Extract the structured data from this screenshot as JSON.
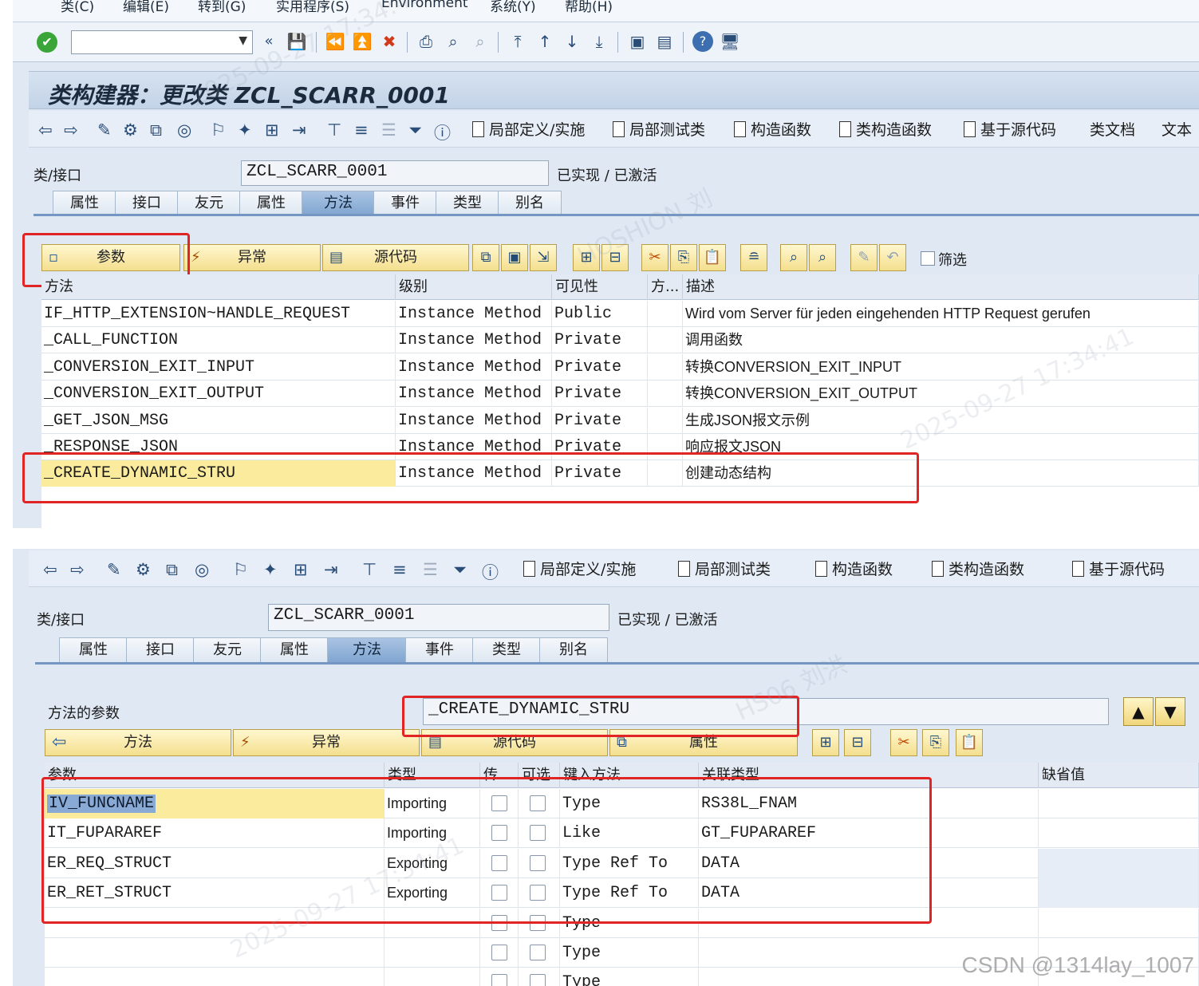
{
  "menu": [
    "类(C)",
    "编辑(E)",
    "转到(G)",
    "实用程序(S)",
    "Environment",
    "系统(Y)",
    "帮助(H)"
  ],
  "title": "类构建器：更改类 ZCL_SCARR_0001",
  "app_toolbar": {
    "local_def": "局部定义/实施",
    "local_test": "局部测试类",
    "constructor": "构造函数",
    "class_constructor": "类构造函数",
    "source_based": "基于源代码",
    "class_doc": "类文档",
    "text": "文本"
  },
  "class_field": {
    "label": "类/接口",
    "value": "ZCL_SCARR_0001",
    "status": "已实现 / 已激活"
  },
  "tabs": [
    "属性",
    "接口",
    "友元",
    "属性",
    "方法",
    "事件",
    "类型",
    "别名"
  ],
  "active_tab": "方法",
  "methods_toolbar": {
    "params": "参数",
    "exceptions": "异常",
    "source": "源代码",
    "filter": "筛选"
  },
  "methods_table": {
    "columns": [
      "方法",
      "级别",
      "可见性",
      "方...",
      "描述"
    ],
    "rows": [
      {
        "method": "IF_HTTP_EXTENSION~HANDLE_REQUEST",
        "level": "Instance Method",
        "visibility": "Public",
        "desc": "Wird vom Server für jeden eingehenden HTTP Request gerufen"
      },
      {
        "method": "_CALL_FUNCTION",
        "level": "Instance Method",
        "visibility": "Private",
        "desc": "调用函数"
      },
      {
        "method": "_CONVERSION_EXIT_INPUT",
        "level": "Instance Method",
        "visibility": "Private",
        "desc": "转换CONVERSION_EXIT_INPUT"
      },
      {
        "method": "_CONVERSION_EXIT_OUTPUT",
        "level": "Instance Method",
        "visibility": "Private",
        "desc": "转换CONVERSION_EXIT_OUTPUT"
      },
      {
        "method": "_GET_JSON_MSG",
        "level": "Instance Method",
        "visibility": "Private",
        "desc": "生成JSON报文示例"
      },
      {
        "method": "_RESPONSE_JSON",
        "level": "Instance Method",
        "visibility": "Private",
        "desc": "响应报文JSON"
      },
      {
        "method": "_CREATE_DYNAMIC_STRU",
        "level": "Instance Method",
        "visibility": "Private",
        "desc": "创建动态结构"
      }
    ]
  },
  "params_section": {
    "label": "方法的参数",
    "method": "_CREATE_DYNAMIC_STRU",
    "buttons": {
      "methods": "方法",
      "exceptions": "异常",
      "source": "源代码",
      "attributes": "属性"
    },
    "columns": [
      "参数",
      "类型",
      "传...",
      "可选",
      "键入方法",
      "关联类型",
      "缺省值"
    ],
    "rows": [
      {
        "param": "IV_FUNCNAME",
        "type": "Importing",
        "typing": "Type",
        "assoc": "RS38L_FNAM"
      },
      {
        "param": "IT_FUPARAREF",
        "type": "Importing",
        "typing": "Like",
        "assoc": "GT_FUPARAREF"
      },
      {
        "param": "ER_REQ_STRUCT",
        "type": "Exporting",
        "typing": "Type Ref To",
        "assoc": "DATA"
      },
      {
        "param": "ER_RET_STRUCT",
        "type": "Exporting",
        "typing": "Type Ref To",
        "assoc": "DATA"
      },
      {
        "param": "",
        "type": "",
        "typing": "Type",
        "assoc": ""
      },
      {
        "param": "",
        "type": "",
        "typing": "Type",
        "assoc": ""
      },
      {
        "param": "",
        "type": "",
        "typing": "Type",
        "assoc": ""
      }
    ]
  },
  "credit": "CSDN @1314lay_1007",
  "colors": {
    "highlight": "#e12525",
    "selected_row": "#fbeb9c",
    "active_tab": "#8fb0d9"
  }
}
